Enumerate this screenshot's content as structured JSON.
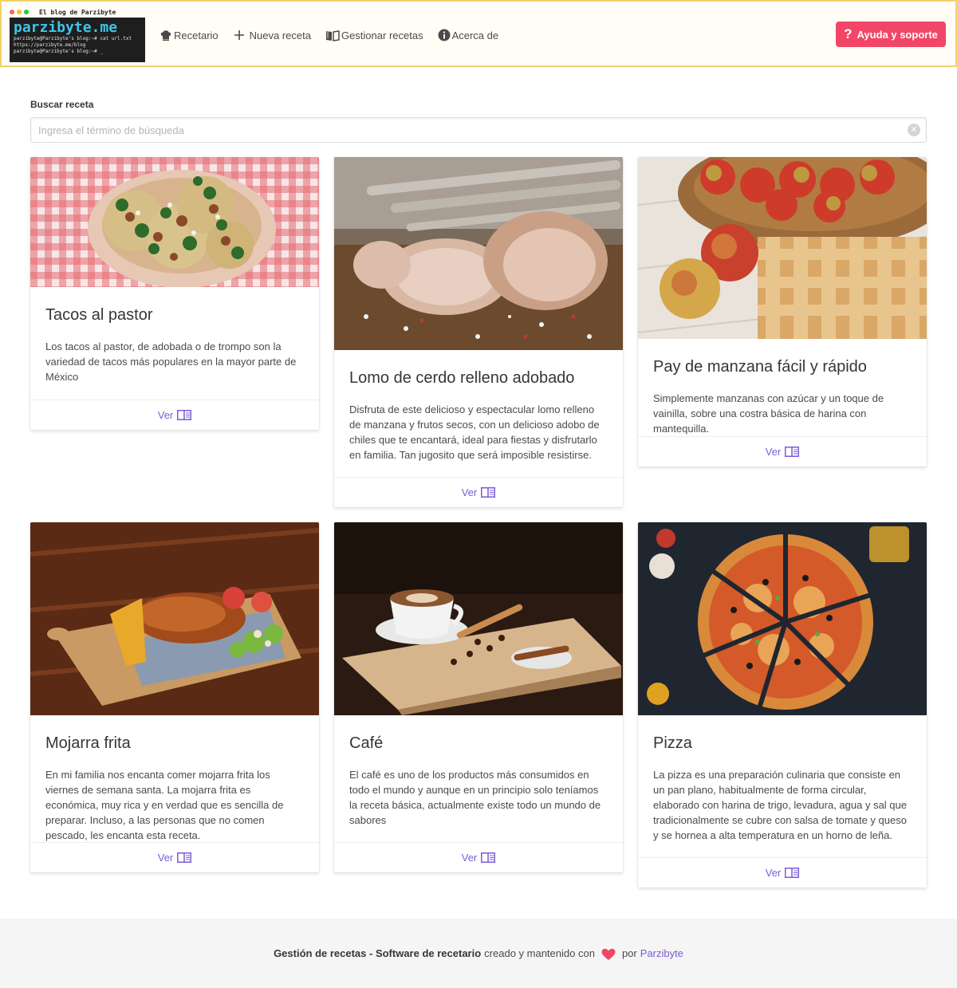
{
  "brand": {
    "blog_title": "El blog de Parzibyte",
    "logo_text": "parzibyte.me",
    "terminal_lines": [
      "parzibyte@Parzibyte's blog:~# cat url.txt",
      "https://parzibyte.me/blog",
      "parzibyte@Parzibyte's blog:~# _"
    ],
    "dot_colors": [
      "#ff5f56",
      "#ffbd2e",
      "#27c93f"
    ]
  },
  "nav": {
    "items": [
      {
        "label": "Recetario",
        "icon": "chef-hat-icon"
      },
      {
        "label": "Nueva receta",
        "icon": "plus-icon"
      },
      {
        "label": "Gestionar recetas",
        "icon": "open-book-icon"
      },
      {
        "label": "Acerca de",
        "icon": "info-circle-icon"
      }
    ],
    "help_label": "Ayuda y soporte",
    "help_icon": "question-icon"
  },
  "search": {
    "label": "Buscar receta",
    "placeholder": "Ingresa el término de búsqueda",
    "value": ""
  },
  "cards": [
    {
      "title": "Tacos al pastor",
      "description": "Los tacos al pastor, de adobada o de trompo son la variedad de tacos más populares en la mayor parte de México",
      "action": "Ver"
    },
    {
      "title": "Lomo de cerdo relleno adobado",
      "description": "Disfruta de este delicioso y espectacular lomo relleno de manzana y frutos secos, con un delicioso adobo de chiles que te encantará, ideal para fiestas y disfrutarlo en familia. Tan jugosito que será imposible resistirse.",
      "action": "Ver"
    },
    {
      "title": "Pay de manzana fácil y rápido",
      "description": "Simplemente manzanas con azúcar y un toque de vainilla, sobre una costra básica de harina con mantequilla.",
      "action": "Ver"
    },
    {
      "title": "Mojarra frita",
      "description": "En mi familia nos encanta comer mojarra frita los viernes de semana santa. La mojarra frita es económica, muy rica y en verdad que es sencilla de preparar. Incluso, a las personas que no comen pescado, les encanta esta receta.",
      "action": "Ver"
    },
    {
      "title": "Café",
      "description": "El café es uno de los productos más consumidos en todo el mundo y aunque en un principio solo teníamos la receta básica, actualmente existe todo un mundo de sabores",
      "action": "Ver"
    },
    {
      "title": "Pizza",
      "description": "La pizza es una preparación culinaria que consiste en un pan plano, habitualmente de forma circular, elaborado con harina de trigo, levadura, agua y sal que tradicionalmente se cubre con salsa de tomate y queso y se hornea a alta temperatura en un horno de leña.",
      "action": "Ver"
    }
  ],
  "footer": {
    "app_name": "Gestión de recetas - Software de recetario",
    "created_text": "creado y mantenido con",
    "by_text": "por",
    "author": "Parzibyte",
    "heart_color": "#f14668",
    "link_color": "#7b5cd6"
  }
}
